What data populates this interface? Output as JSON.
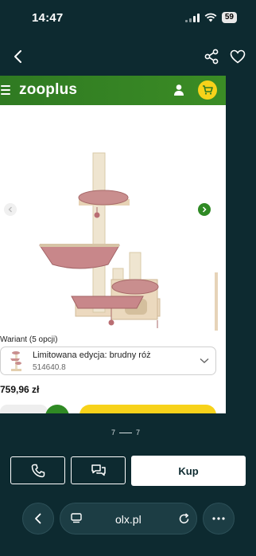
{
  "status_bar": {
    "time": "14:47",
    "battery": "59"
  },
  "product_card": {
    "brand": "zooplus",
    "variant_label": "Wariant (5 opcji)",
    "variant_title": "Limitowana edycja: brudny róż",
    "variant_sku": "514640.8",
    "price": "759,96 zł"
  },
  "gallery": {
    "current": "7",
    "total": "7"
  },
  "actions": {
    "buy_label": "Kup"
  },
  "browser": {
    "url": "olx.pl"
  },
  "colors": {
    "background": "#0d2a30",
    "zooplus_green": "#3b8c25",
    "zooplus_yellow": "#f7d21a"
  }
}
